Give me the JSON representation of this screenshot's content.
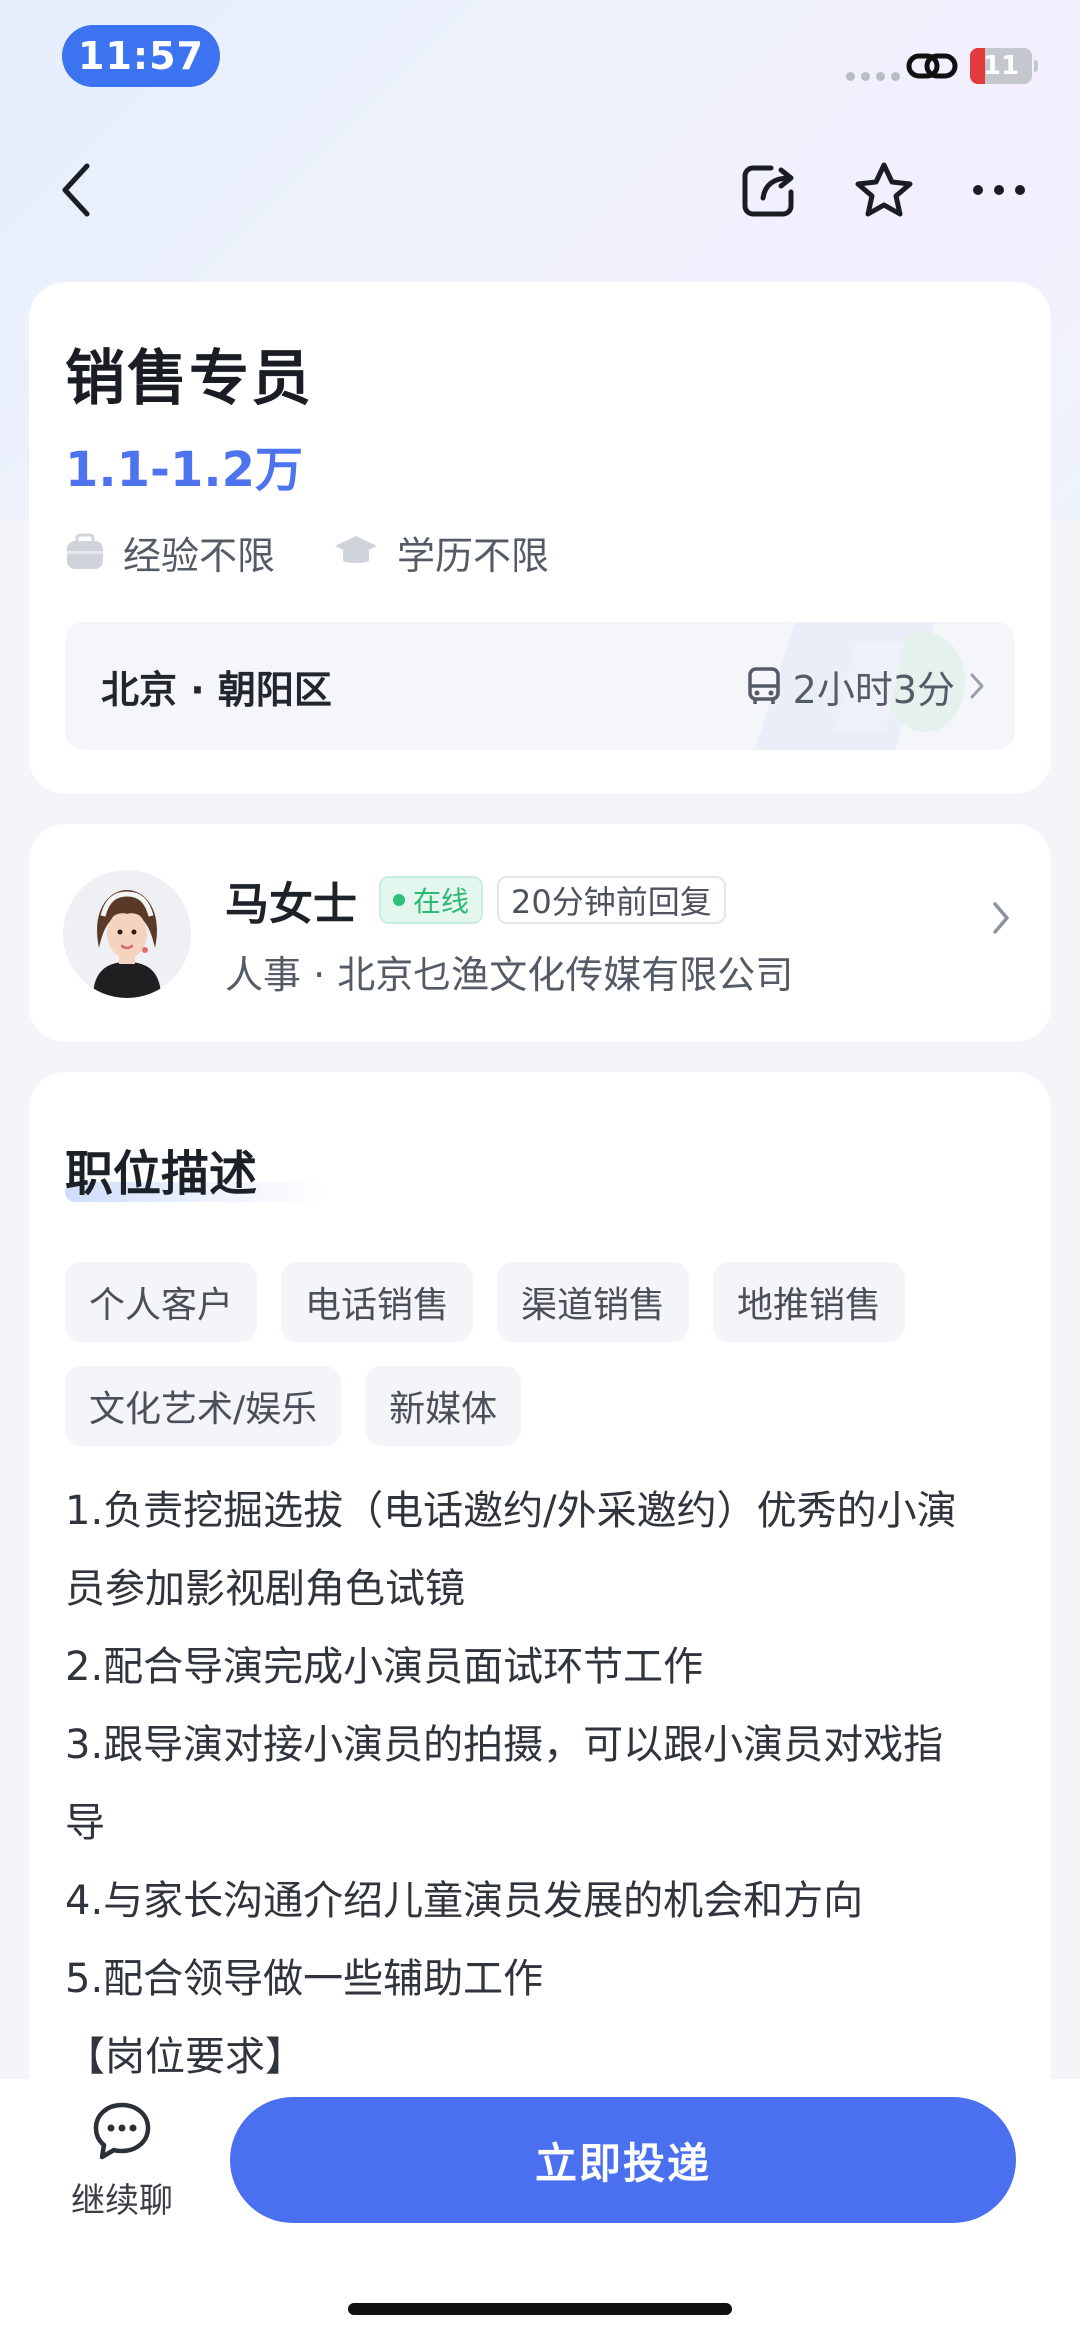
{
  "status_bar": {
    "time": "11:57",
    "battery_percent": "11",
    "battery_level": 0.11,
    "battery_color": "#e23b3b"
  },
  "nav": {
    "back_icon": "chevron-left-icon",
    "share_icon": "share-icon",
    "favorite_icon": "star-icon",
    "more_icon": "more-icon"
  },
  "job": {
    "title": "销售专员",
    "salary": "1.1-1.2万",
    "experience": "经验不限",
    "education": "学历不限",
    "location": "北京 · 朝阳区",
    "commute": "2小时3分",
    "salary_color": "#4d73ee"
  },
  "recruiter": {
    "name": "马女士",
    "status": "在线",
    "reply": "20分钟前回复",
    "company": "人事 · 北京乜渔文化传媒有限公司"
  },
  "description": {
    "title": "职位描述",
    "tags": [
      "个人客户",
      "电话销售",
      "渠道销售",
      "地推销售",
      "文化艺术/娱乐",
      "新媒体"
    ],
    "lines": [
      "1.负责挖掘选拔（电话邀约/外采邀约）优秀的小演",
      "员参加影视剧角色试镜",
      "2.配合导演完成小演员面试环节工作",
      "3.跟导演对接小演员的拍摄，可以跟小演员对戏指",
      "导",
      "4.与家长沟通介绍儿童演员发展的机会和方向",
      "5.配合领导做一些辅助工作",
      "【岗位要求】"
    ]
  },
  "bottom": {
    "chat_label": "继续聊",
    "apply_label": "立即投递",
    "accent_color": "#4b70ef"
  }
}
